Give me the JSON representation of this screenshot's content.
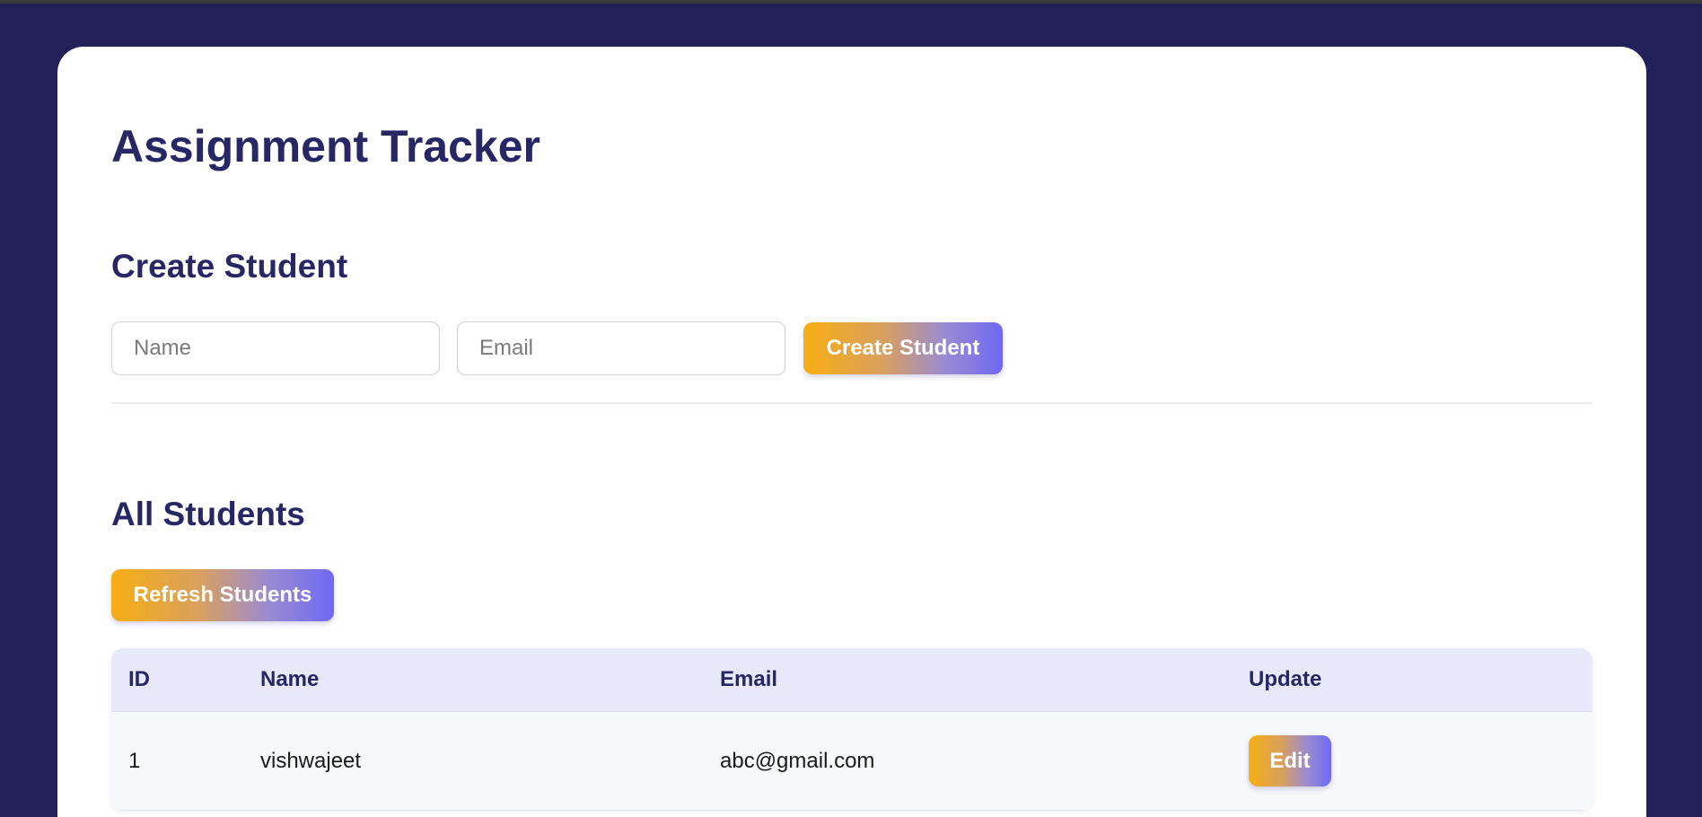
{
  "app": {
    "title": "Assignment Tracker"
  },
  "create_section": {
    "heading": "Create Student",
    "name_placeholder": "Name",
    "name_value": "",
    "email_placeholder": "Email",
    "email_value": "",
    "submit_label": "Create Student"
  },
  "list_section": {
    "heading": "All Students",
    "refresh_label": "Refresh Students"
  },
  "table": {
    "columns": [
      "ID",
      "Name",
      "Email",
      "Update"
    ],
    "rows": [
      {
        "id": "1",
        "name": "vishwajeet",
        "email": "abc@gmail.com",
        "action_label": "Edit"
      }
    ]
  },
  "colors": {
    "page_background": "#22215a",
    "heading": "#272766",
    "button_gradient_start": "#f7ae12",
    "button_gradient_end": "#6f68f4",
    "table_header": "#e7e8f9"
  }
}
